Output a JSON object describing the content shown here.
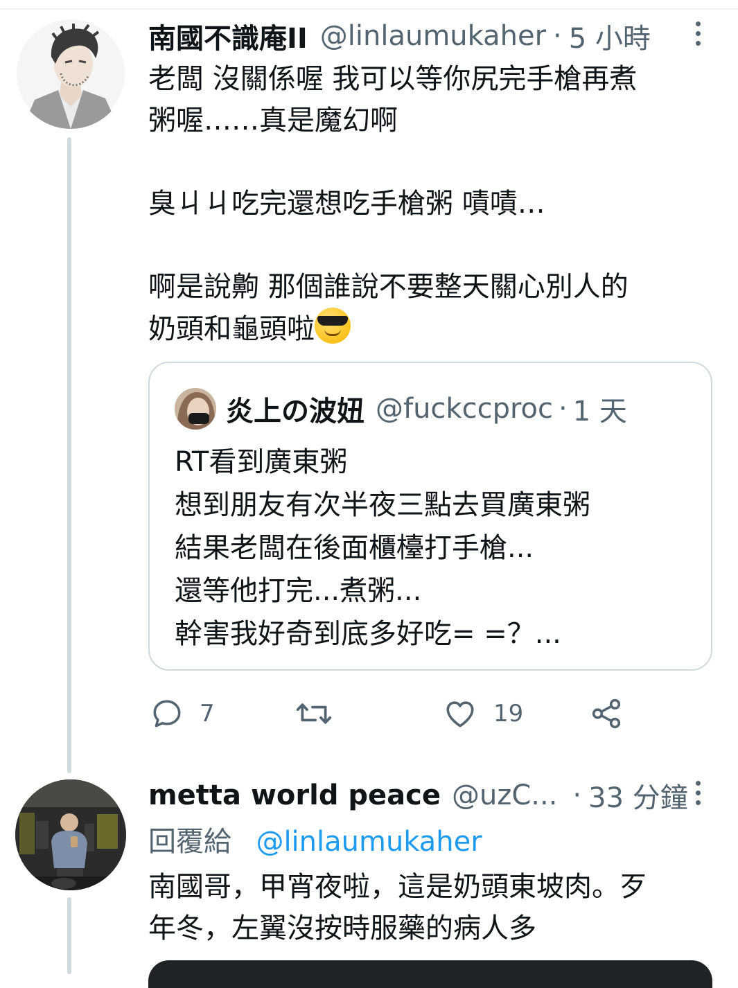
{
  "tweet1": {
    "name": "南國不識庵II",
    "handle": "@linlaumukaher",
    "separator": "·",
    "time": "5 小時",
    "body_lines": [
      "老闆 沒關係喔 我可以等你尻完手槍再煮",
      "粥喔……真是魔幻啊",
      "",
      "臭ㄐㄐ吃完還想吃手槍粥 嘖嘖…",
      "",
      "啊是說齁 那個誰說不要整天關心別人的",
      "奶頭和龜頭啦"
    ],
    "quote": {
      "name": "炎上の波妞",
      "handle": "@fuckccproc",
      "separator": "·",
      "time": "1 天",
      "body_lines": [
        "RT看到廣東粥",
        "想到朋友有次半夜三點去買廣東粥",
        "結果老闆在後面櫃檯打手槍...",
        "還等他打完...煮粥...",
        "幹害我好奇到底多好吃=  =？..."
      ]
    },
    "actions": {
      "reply_count": "7",
      "retweet_count": "",
      "like_count": "19"
    }
  },
  "tweet2": {
    "name": "metta world peace",
    "handle": "@uzC...",
    "separator": "·",
    "time": "33 分鐘",
    "reply_prefix": "回覆給",
    "reply_target": "@linlaumukaher",
    "body_lines": [
      "南國哥，甲宵夜啦，這是奶頭東坡肉。歹",
      "年冬，左翼沒按時服藥的病人多"
    ]
  },
  "icons": {
    "reply": "speech-bubble-icon",
    "retweet": "retweet-icon",
    "like": "heart-icon",
    "share": "share-icon",
    "more": "more-vertical-icon",
    "emoji": "smiling-face-with-sunglasses-emoji"
  },
  "colors": {
    "text": "#0f1419",
    "secondary": "#536471",
    "link": "#1d9bf0",
    "border": "#cfd9de"
  }
}
